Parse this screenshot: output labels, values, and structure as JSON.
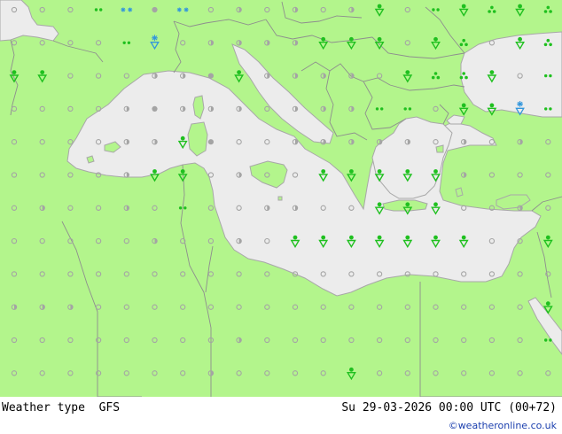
{
  "map": {
    "land_color": "#b3f58c",
    "sea_color": "#ececec",
    "border_color": "#8e8e8e",
    "coast_color": "#a8a8a8"
  },
  "footer": {
    "product": "Weather type",
    "model": "GFS",
    "valid": "Su 29-03-2026 00:00 UTC (00+72)",
    "credit": "©weatheronline.co.uk"
  },
  "legend_symbols": {
    "clear": {
      "color": "#a4a4a4",
      "icon": "empty-circle"
    },
    "partly_cloudy": {
      "color": "#a4a4a4",
      "icon": "half-circle"
    },
    "cloudy": {
      "color": "#a4a4a4",
      "icon": "filled-circle"
    },
    "light_rain": {
      "color": "#1fc01f",
      "icon": "two-dots"
    },
    "rain": {
      "color": "#1fc01f",
      "icon": "three-dots"
    },
    "rain_shower": {
      "color": "#1fc01f",
      "icon": "dot-over-triangle"
    },
    "snow_shower": {
      "color": "#3296dc",
      "icon": "snowflake-over-triangle"
    },
    "snow": {
      "color": "#3296dc",
      "icon": "snowflake"
    },
    "light_snow": {
      "color": "#3296dc",
      "icon": "two-snowflakes"
    }
  },
  "symbol_grid": [
    "EEEHLCLEFEFEFGEHGIGIGIGEG",
    "EEEEHKEFFFFGGGEGIEGIEFHFH",
    "GGEEEFFCGFFFFEGIIGEHFEEIG",
    "EEEEFCFFFEFFFHHEGGKHHEGEF",
    "EEEEFFGCEEFFFFFEFEFEFEFHH",
    "EEEEFGGEFEEGGGGGFEEEGGHGF",
    "EFEEFEHEEFFEEGGGEEFEGHGEH",
    "EEEEEFEEFEGGGGGGGEEGGFHEE",
    "EEEEEEEEEEEEEEEEEEEEGHHEE",
    "FFFEEEEEEEEEEEEEEEEGEEEEF",
    "EEEEEEEEFEEEEEEEEEEHEEEEE",
    "EEEEEEEFEEEEGEEEEEEEEEEEE"
  ]
}
